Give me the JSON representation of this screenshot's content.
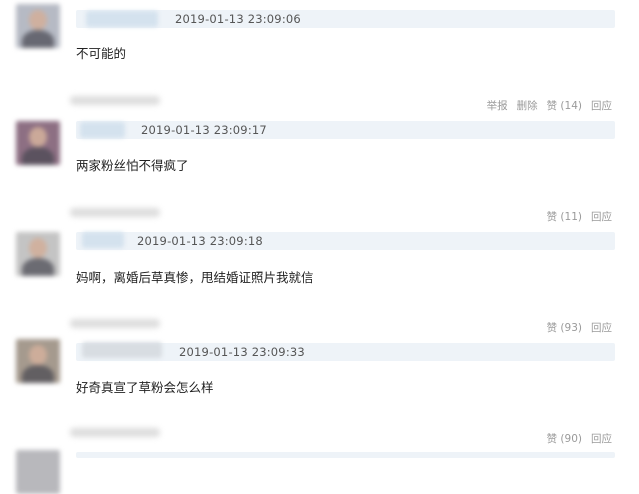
{
  "comments": [
    {
      "timestamp": "2019-01-13 23:09:06",
      "text": "不可能的",
      "actions": {
        "report": "举报",
        "delete": "删除",
        "like": "赞 (14)",
        "reply": "回应"
      }
    },
    {
      "timestamp": "2019-01-13 23:09:17",
      "text": "两家粉丝怕不得疯了",
      "actions": {
        "like": "赞 (11)",
        "reply": "回应"
      }
    },
    {
      "timestamp": "2019-01-13 23:09:18",
      "text": "妈啊，离婚后草真惨，甩结婚证照片我就信",
      "actions": {
        "like": "赞 (93)",
        "reply": "回应"
      }
    },
    {
      "timestamp": "2019-01-13 23:09:33",
      "text": "好奇真宣了草粉会怎么样",
      "actions": {
        "like": "赞 (90)",
        "reply": "回应"
      }
    }
  ],
  "colors": {
    "meta_bar": "#eef3f8",
    "action_text": "#9a9a9a",
    "timestamp_text": "#555555"
  }
}
